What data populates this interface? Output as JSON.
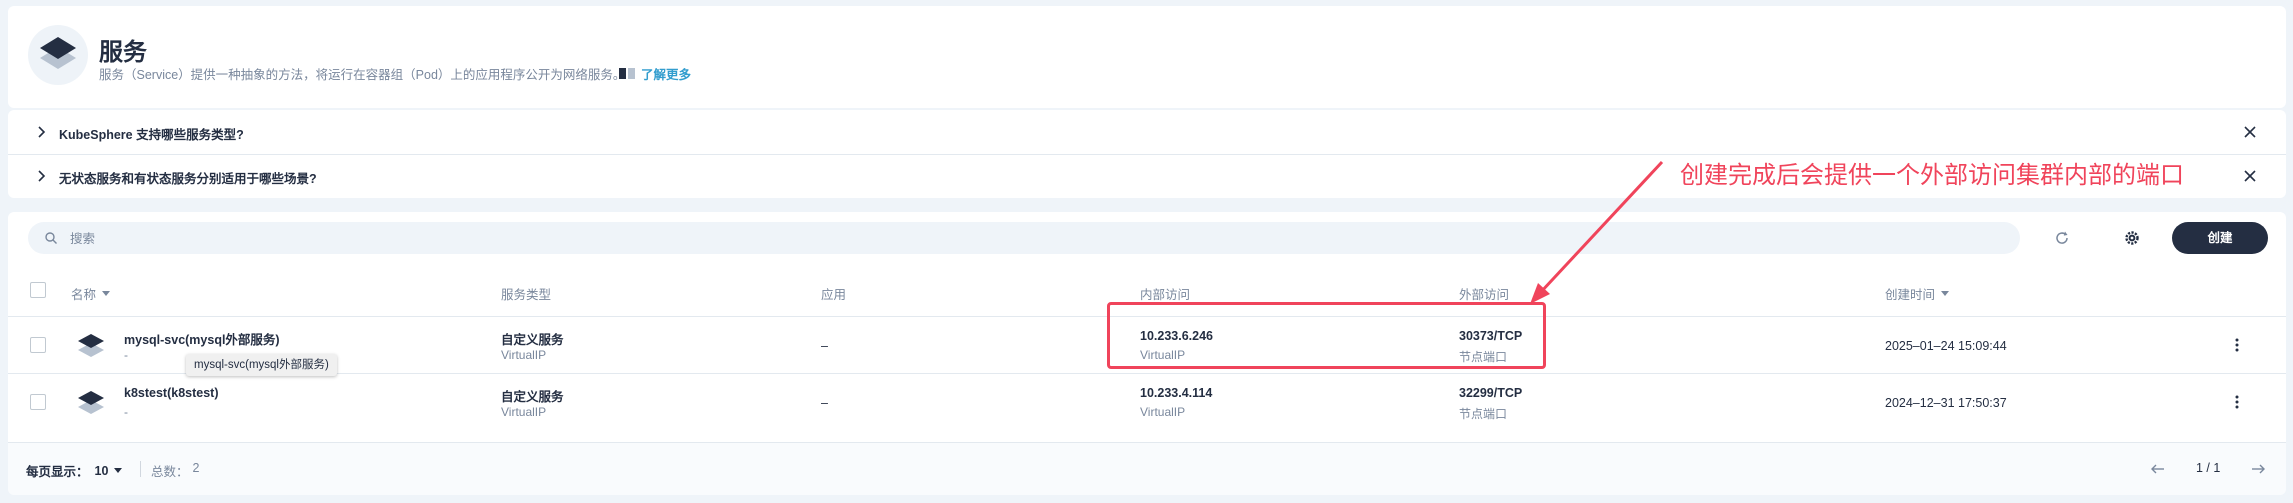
{
  "header": {
    "title": "服务",
    "description": "服务（Service）提供一种抽象的方法，将运行在容器组（Pod）上的应用程序公开为网络服务。",
    "learn_more": "了解更多"
  },
  "faq": [
    {
      "question": "KubeSphere 支持哪些服务类型?"
    },
    {
      "question": "无状态服务和有状态服务分别适用于哪些场景?"
    }
  ],
  "toolbar": {
    "search_placeholder": "搜索",
    "create_label": "创建"
  },
  "table": {
    "columns": {
      "name": "名称",
      "type": "服务类型",
      "app": "应用",
      "internal": "内部访问",
      "external": "外部访问",
      "created": "创建时间"
    },
    "rows": [
      {
        "name": "mysql-svc(mysql外部服务)",
        "name_sub": "-",
        "type": "自定义服务",
        "type_sub": "VirtualIP",
        "app": "–",
        "internal_ip": "10.233.6.246",
        "internal_sub": "VirtualIP",
        "external_port": "30373/TCP",
        "external_sub": "节点端口",
        "created": "2025–01–24 15:09:44"
      },
      {
        "name": "k8stest(k8stest)",
        "name_sub": "-",
        "type": "自定义服务",
        "type_sub": "VirtualIP",
        "app": "–",
        "internal_ip": "10.233.4.114",
        "internal_sub": "VirtualIP",
        "external_port": "32299/TCP",
        "external_sub": "节点端口",
        "created": "2024–12–31 17:50:37"
      }
    ]
  },
  "tooltip": "mysql-svc(mysql外部服务)",
  "footer": {
    "per_page_label": "每页显示：",
    "per_page_value": "10",
    "total_label": "总数：",
    "total_value": "2",
    "page_info": "1 / 1"
  },
  "annotation": {
    "text": "创建完成后会提供一个外部访问集群内部的端口",
    "color": "#f0445b"
  },
  "colors": {
    "primary_dark": "#242e42",
    "muted_text": "#79879c",
    "link": "#329dce",
    "page_bg": "#eff4f9"
  }
}
